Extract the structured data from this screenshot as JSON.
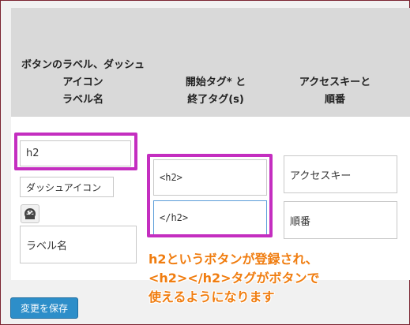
{
  "table": {
    "headers": {
      "col1_line1": "ボタンのラベル、ダッシュ",
      "col1_line2": "アイコン",
      "col1_line3": "ラベル名",
      "col2_line1": "開始タグ* と",
      "col2_line2": "終了タグ(s)",
      "col3_line1": "アクセスキーと",
      "col3_line2": "順番"
    },
    "row": {
      "button_label": "h2",
      "dashicon_button_label": "ダッシュアイコン",
      "label_name_placeholder": "ラベル名",
      "start_tag": "<h2>",
      "end_tag": "</h2>",
      "access_key_placeholder": "アクセスキー",
      "order_placeholder": "順番"
    }
  },
  "annotation": {
    "line1": "h2というボタンが登録され、",
    "line2": "<h2></h2>タグがボタンで",
    "line3": "使えるようになります",
    "color": "#f07d10",
    "highlight_color": "#c42ec0"
  },
  "footer": {
    "save_label": "変更を保存"
  }
}
